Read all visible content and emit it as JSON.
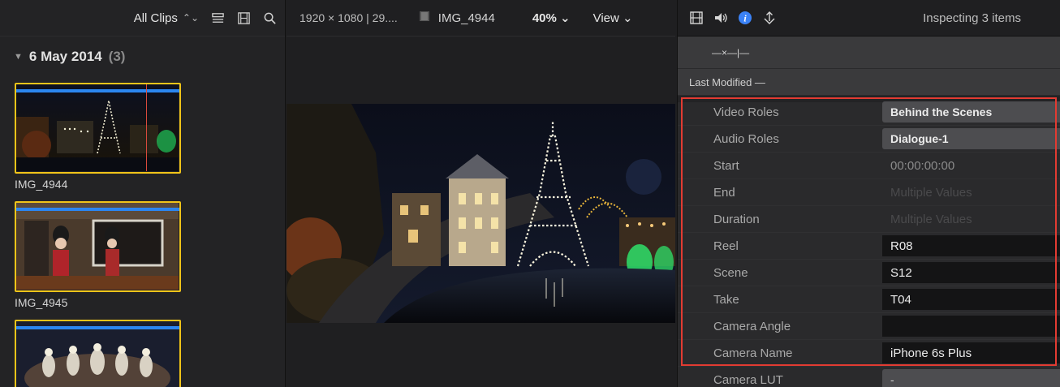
{
  "browser": {
    "filter_label": "All Clips",
    "event": {
      "title": "6 May 2014",
      "count": "(3)"
    },
    "clips": [
      {
        "name": "IMG_4944"
      },
      {
        "name": "IMG_4945"
      },
      {
        "name": ""
      }
    ]
  },
  "viewer": {
    "resolution": "1920 × 1080 | 29....",
    "clip_name": "IMG_4944",
    "zoom": "40% ⌄",
    "view_label": "View ⌄"
  },
  "inspector": {
    "title": "Inspecting 3 items",
    "meta_top": "—×—|—",
    "meta_sort": "Last Modified —",
    "properties": [
      {
        "label": "Video Roles",
        "value": "Behind the Scenes"
      },
      {
        "label": "Audio Roles",
        "value": "Dialogue-1"
      },
      {
        "label": "Start",
        "value": "00:00:00:00"
      },
      {
        "label": "End",
        "value": "Multiple Values"
      },
      {
        "label": "Duration",
        "value": "Multiple Values"
      },
      {
        "label": "Reel",
        "value": "R08"
      },
      {
        "label": "Scene",
        "value": "S12"
      },
      {
        "label": "Take",
        "value": "T04"
      },
      {
        "label": "Camera Angle",
        "value": ""
      },
      {
        "label": "Camera Name",
        "value": "iPhone 6s Plus"
      },
      {
        "label": "Camera LUT",
        "value": "-"
      }
    ]
  },
  "colors": {
    "selection_border": "#f0c419",
    "role_bar": "#2b86f0",
    "highlight": "#e23b32",
    "info_icon": "#3b82f6"
  }
}
